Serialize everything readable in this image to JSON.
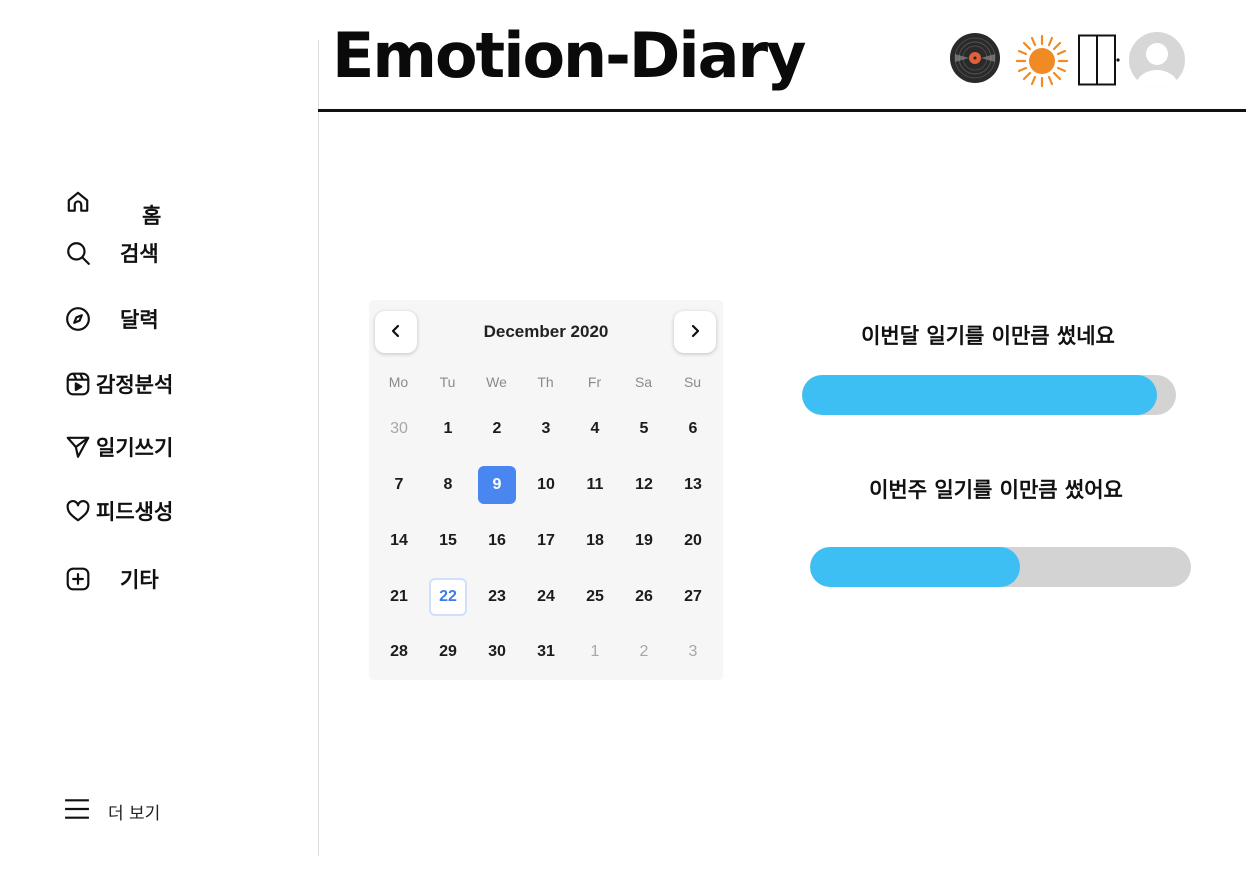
{
  "header": {
    "title": "Emotion-Diary",
    "icons": [
      "vinyl-record-icon",
      "sun-icon",
      "door-icon",
      "avatar"
    ]
  },
  "sidebar": {
    "items": [
      {
        "label": "홈",
        "icon": "home-icon"
      },
      {
        "label": "검색",
        "icon": "search-icon"
      },
      {
        "label": "달력",
        "icon": "compass-icon"
      },
      {
        "label": "감정분석",
        "icon": "reels-icon"
      },
      {
        "label": "일기쓰기",
        "icon": "send-icon"
      },
      {
        "label": "피드생성",
        "icon": "heart-icon"
      },
      {
        "label": "기타",
        "icon": "plus-square-icon"
      }
    ],
    "more_label": "더 보기"
  },
  "calendar": {
    "month_label": "December 2020",
    "weekdays": [
      "Mo",
      "Tu",
      "We",
      "Th",
      "Fr",
      "Sa",
      "Su"
    ],
    "weeks": [
      [
        "30",
        "1",
        "2",
        "3",
        "4",
        "5",
        "6"
      ],
      [
        "7",
        "8",
        "9",
        "10",
        "11",
        "12",
        "13"
      ],
      [
        "14",
        "15",
        "16",
        "17",
        "18",
        "19",
        "20"
      ],
      [
        "21",
        "22",
        "23",
        "24",
        "25",
        "26",
        "27"
      ],
      [
        "28",
        "29",
        "30",
        "31",
        "1",
        "2",
        "3"
      ]
    ],
    "selected_day": "9",
    "today_day": "22",
    "accent": "#4a86f0"
  },
  "progress": {
    "month_label": "이번달 일기를 이만큼 썼네요",
    "month_fraction": 0.95,
    "week_label": "이번주 일기를 이만큼 썼어요",
    "week_fraction": 0.55,
    "fill_color": "#3ebff4",
    "track_color": "#d3d3d3"
  }
}
